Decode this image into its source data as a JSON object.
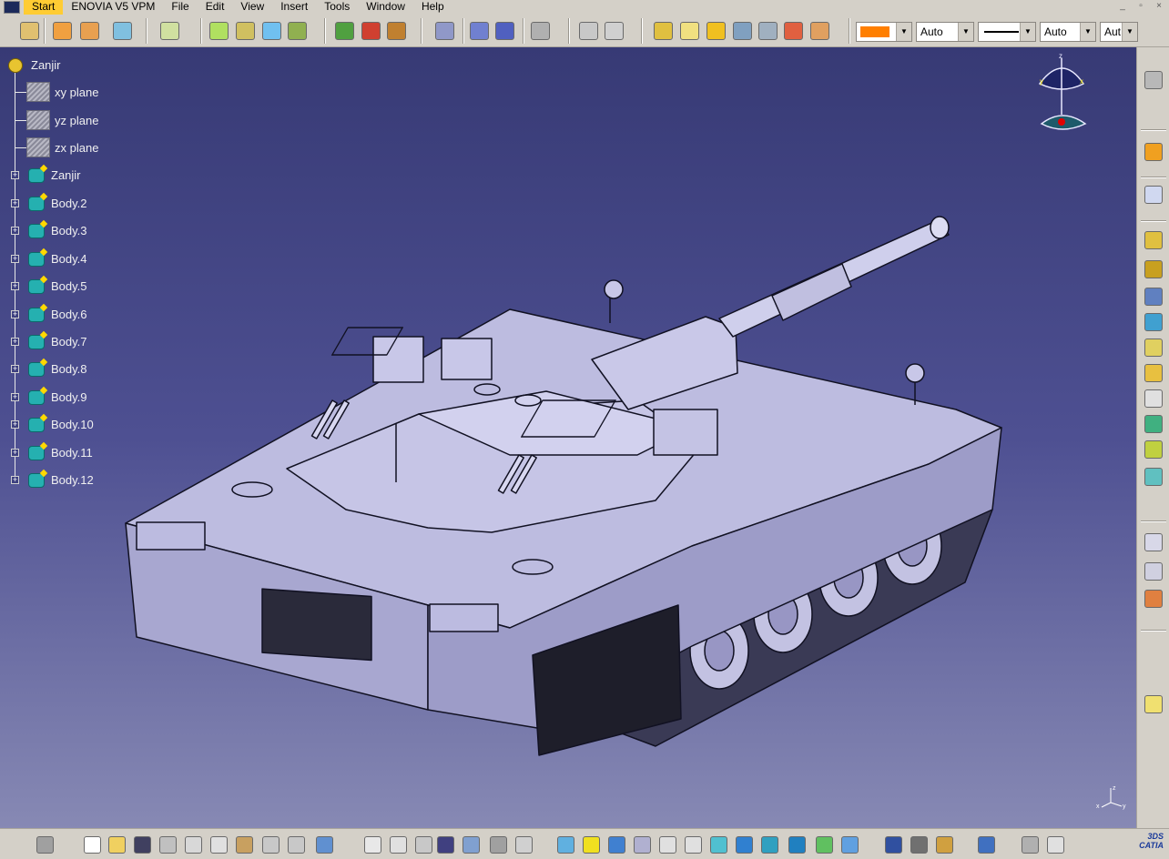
{
  "menu": {
    "items": [
      {
        "label": "Start",
        "active": true
      },
      {
        "label": "ENOVIA V5 VPM"
      },
      {
        "label": "File"
      },
      {
        "label": "Edit"
      },
      {
        "label": "View"
      },
      {
        "label": "Insert"
      },
      {
        "label": "Tools"
      },
      {
        "label": "Window"
      },
      {
        "label": "Help"
      }
    ]
  },
  "window_controls": {
    "minimize": "_",
    "restore": "▫",
    "close": "×"
  },
  "graphic_properties": {
    "fill_color": "#ff7f00",
    "line_type_value": "Auto",
    "line_thickness_value": "Auto",
    "point_type_value": "Aut"
  },
  "tree": {
    "root": "Zanjir",
    "planes": [
      "xy plane",
      "yz plane",
      "zx plane"
    ],
    "bodies": [
      "Zanjir",
      "Body.2",
      "Body.3",
      "Body.4",
      "Body.5",
      "Body.6",
      "Body.7",
      "Body.8",
      "Body.9",
      "Body.10",
      "Body.11",
      "Body.12"
    ]
  },
  "compass": {
    "axis_x": "x",
    "axis_y": "y",
    "axis_z": "z"
  },
  "mini_axis": {
    "x": "x",
    "y": "y",
    "z": "z"
  },
  "logo": {
    "text_top": "3DS",
    "text_bottom": "CATIA"
  },
  "colors": {
    "viewport_top": "#373a75",
    "viewport_bottom": "#8789b4",
    "model_face": "#b7b6db",
    "model_edge": "#111122",
    "menu_active": "#ffcc33"
  }
}
